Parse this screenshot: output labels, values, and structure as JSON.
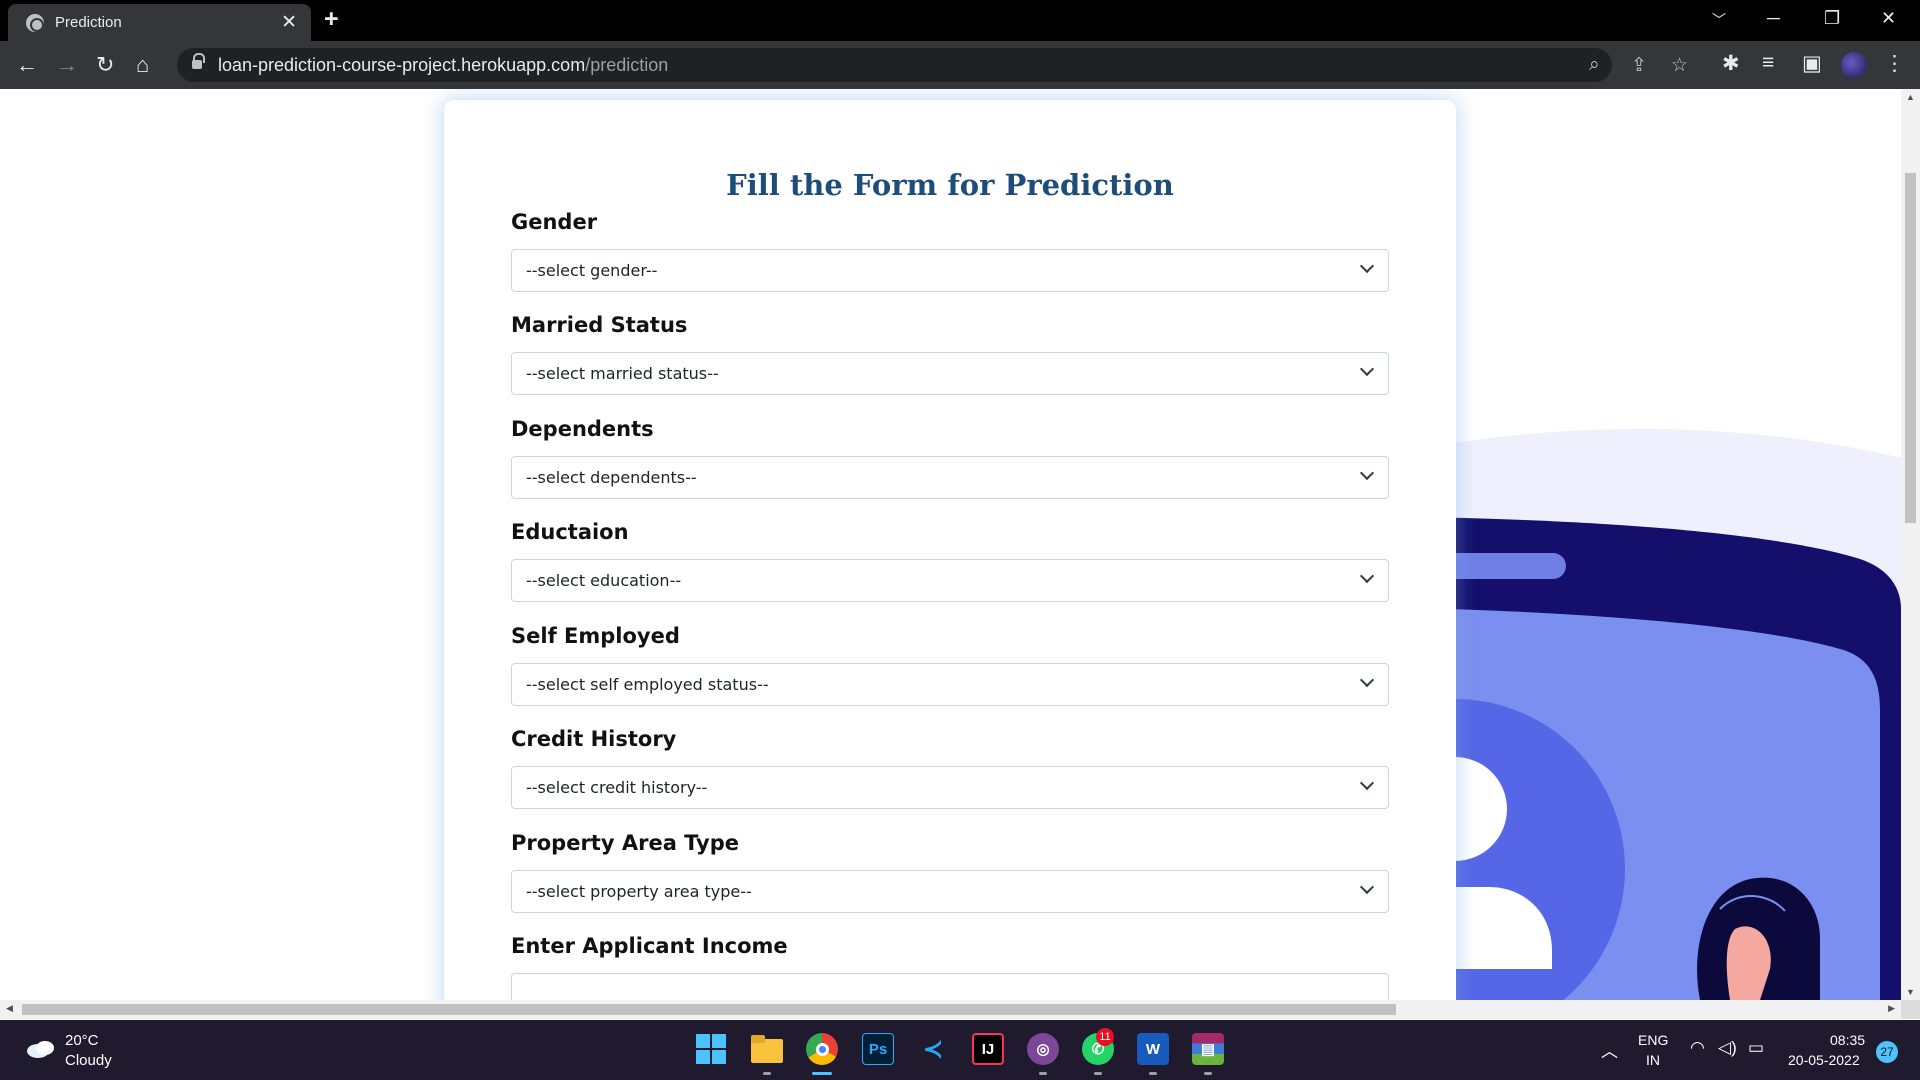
{
  "browser": {
    "tab_title": "Prediction",
    "tab_close": "✕",
    "new_tab": "+",
    "url_host": "loan-prediction-course-project.herokuapp.com",
    "url_path": "/prediction"
  },
  "form": {
    "title": "Fill the Form for Prediction",
    "fields": [
      {
        "label": "Gender",
        "value": "--select gender--"
      },
      {
        "label": "Married Status",
        "value": "--select married status--"
      },
      {
        "label": "Dependents",
        "value": "--select dependents--"
      },
      {
        "label": "Eductaion",
        "value": "--select education--"
      },
      {
        "label": "Self Employed",
        "value": "--select self employed status--"
      },
      {
        "label": "Credit History",
        "value": "--select credit history--"
      },
      {
        "label": "Property Area Type",
        "value": "--select property area type--"
      },
      {
        "label": "Enter Applicant Income",
        "value": ""
      }
    ]
  },
  "taskbar": {
    "weather_temp": "20°C",
    "weather_cond": "Cloudy",
    "lang_top": "ENG",
    "lang_bottom": "IN",
    "time": "08:35",
    "date": "20-05-2022",
    "notifications": "27",
    "whatsapp_badge": "11",
    "apps": [
      "start",
      "file-explorer",
      "chrome",
      "photoshop",
      "vs-code",
      "intellij",
      "tor",
      "whatsapp",
      "word",
      "winrar"
    ]
  },
  "colors": {
    "title": "#1e4d7b",
    "illustration_dark": "#130f6b",
    "illustration_mid": "#7b8ff0",
    "illustration_light": "#a9bff8"
  }
}
